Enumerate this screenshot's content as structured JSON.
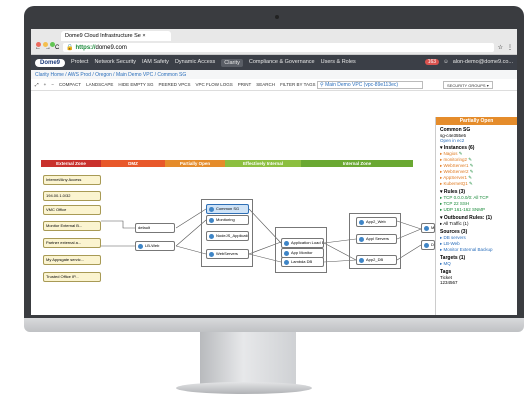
{
  "browser": {
    "tab_title": "Dome9 Cloud Infrastructure Se",
    "url_host": "https://",
    "url_rest": "dome9.com",
    "dot_colors": [
      "#ec6a5e",
      "#f4bf4f",
      "#61c554"
    ]
  },
  "nav": {
    "logo": "Dome9",
    "items": [
      "Protect",
      "Network Security",
      "IAM Safety",
      "Dynamic Access",
      "Clarity",
      "Compliance & Governance",
      "Users & Roles"
    ],
    "active_index": 4,
    "badge": "163",
    "user": "alon-demo@dome9.co..."
  },
  "breadcrumb": "Clarity Home  /  AWS Prod  /  Oregon  /  Main Demo VPC  /  Common SG",
  "toolbar": {
    "items": [
      "COMPACT",
      "LANDSCAPE",
      "HIDE EMPTY SG",
      "PEERED VPCS",
      "VPC FLOW LOGS",
      "PRINT",
      "SEARCH",
      "FILTER BY TAGS"
    ],
    "search_value": "Main Demo VPC (vpc-89e113ec)",
    "group_select": "SECURITY GROUPS"
  },
  "zones": [
    {
      "label": "External Zone",
      "color": "#c9302c"
    },
    {
      "label": "DMZ",
      "color": "#e8582a"
    },
    {
      "label": "Partially Open",
      "color": "#e58c2b"
    },
    {
      "label": "Effectively Internal",
      "color": "#8cbf3f"
    },
    {
      "label": "Internal Zone",
      "color": "#6aa832"
    }
  ],
  "external_nodes": [
    "Internet/Any Access",
    "194.00.1.0/32",
    "VMC Office",
    "Monitor External B...",
    "Partner external a...",
    "My Appsgate servic...",
    "Trusted Office IP..."
  ],
  "sg_nodes": {
    "default": "default",
    "lb": "LB-Web",
    "common": "Common SG",
    "monitoring": "Monitoring",
    "app_lb": "Application Load B...",
    "nodejs": "NodeJS_ApplicationSe...",
    "webservers": "WebServers",
    "app_servers_mid": "App Monitor",
    "lambda": "Lambda DB",
    "app2_web": "App2_Web",
    "app_servers": "Appl Servers",
    "app2_db": "App2_DB",
    "mq": "MQ",
    "db_servers": "DB servers"
  },
  "panel": {
    "header": "Partially Open",
    "title": "Common SG",
    "id": "sg-c4e355e5",
    "open_label": "Open in ec2",
    "instances_title": "Instances (6)",
    "instances": [
      "Nagios",
      "monitoring2",
      "WebServer1",
      "WebServer2",
      "AppServer1",
      "KubernetQ1"
    ],
    "rules_title": "Rules (3)",
    "rules": [
      "TCP 0.0.0.0/0: All TCP",
      "TCP 22 SSH",
      "UDP 161-162 SNMP"
    ],
    "outbound_title": "Outbound Rules: (1)",
    "outbound": [
      "All Traffic (1)"
    ],
    "sources_title": "Sources (3)",
    "sources": [
      "DB servers",
      "LB-Web",
      "Monitor External Backup"
    ],
    "targets_title": "Targets (1)",
    "targets": [
      "MQ"
    ],
    "tags_title": "Tags",
    "tag_key": "Ticket",
    "tag_value": "1234567"
  }
}
